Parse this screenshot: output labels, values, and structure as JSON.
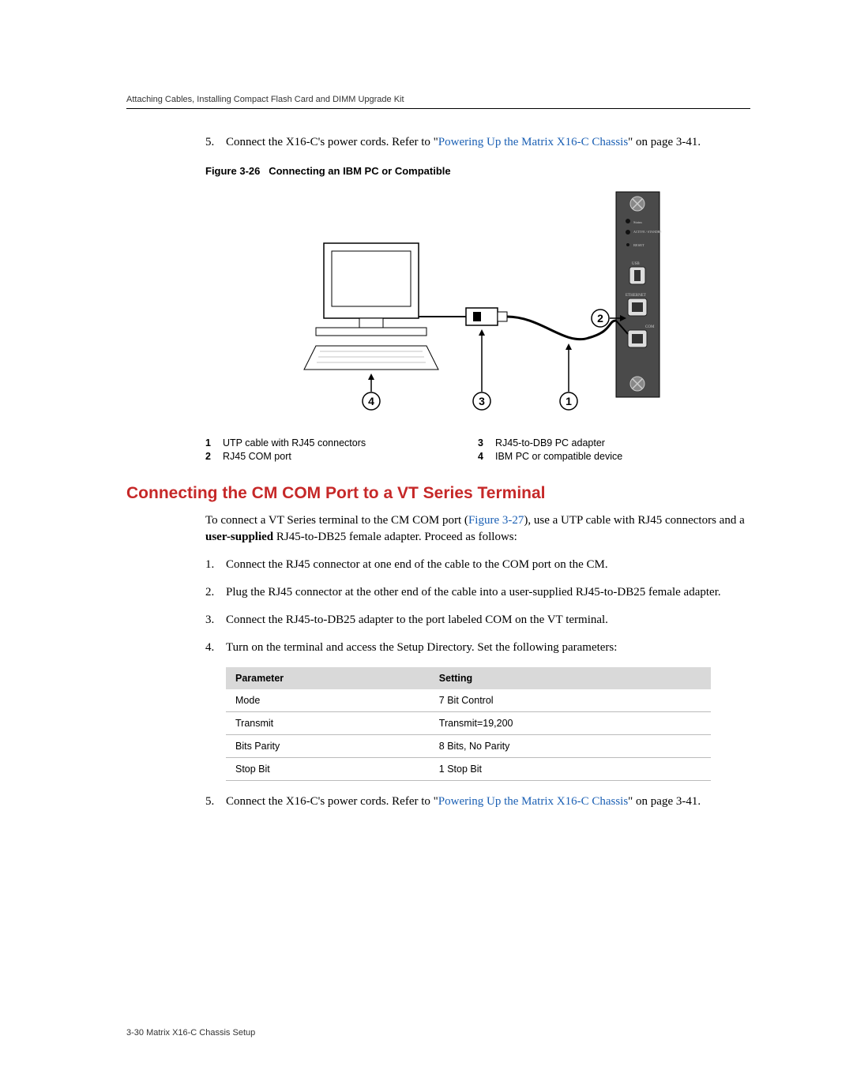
{
  "running_head": "Attaching Cables, Installing Compact Flash Card and DIMM Upgrade Kit",
  "step5_pre": "Connect the X16-C's power cords. Refer to \"",
  "step5_link": "Powering Up the Matrix X16-C Chassis",
  "step5_post": "\" on page 3-41.",
  "figure_label": "Figure 3-26",
  "figure_title": "Connecting an IBM PC or Compatible",
  "legend": {
    "l1": "UTP cable with RJ45 connectors",
    "l2": "RJ45 COM port",
    "l3": "RJ45-to-DB9 PC adapter",
    "l4": "IBM PC or compatible device"
  },
  "section_heading": "Connecting the CM COM Port to a VT Series Terminal",
  "intro_pre": "To connect a VT Series terminal to the CM COM port (",
  "intro_link": "Figure 3-27",
  "intro_post": "), use a UTP cable with RJ45 connectors and a ",
  "intro_bold": "user-supplied",
  "intro_end": " RJ45-to-DB25 female adapter. Proceed as follows:",
  "steps": {
    "s1": "Connect the RJ45 connector at one end of the cable to the COM port on the CM.",
    "s2": "Plug the RJ45 connector at the other end of the cable into a user-supplied RJ45-to-DB25 female adapter.",
    "s3": "Connect the RJ45-to-DB25 adapter to the port labeled COM on the VT terminal.",
    "s4": "Turn on the terminal and access the Setup Directory. Set the following parameters:"
  },
  "table": {
    "h1": "Parameter",
    "h2": "Setting",
    "rows": [
      {
        "p": "Mode",
        "s": "7 Bit Control"
      },
      {
        "p": "Transmit",
        "s": "Transmit=19,200"
      },
      {
        "p": "Bits Parity",
        "s": "8 Bits, No Parity"
      },
      {
        "p": "Stop Bit",
        "s": "1 Stop Bit"
      }
    ]
  },
  "footer": "3-30   Matrix X16-C Chassis Setup",
  "labels": {
    "usb": "USB",
    "eth": "ETHERNET",
    "com": "COM",
    "status": "Status",
    "active": "ACTIVE / STANDBY",
    "reset": "RESET"
  }
}
